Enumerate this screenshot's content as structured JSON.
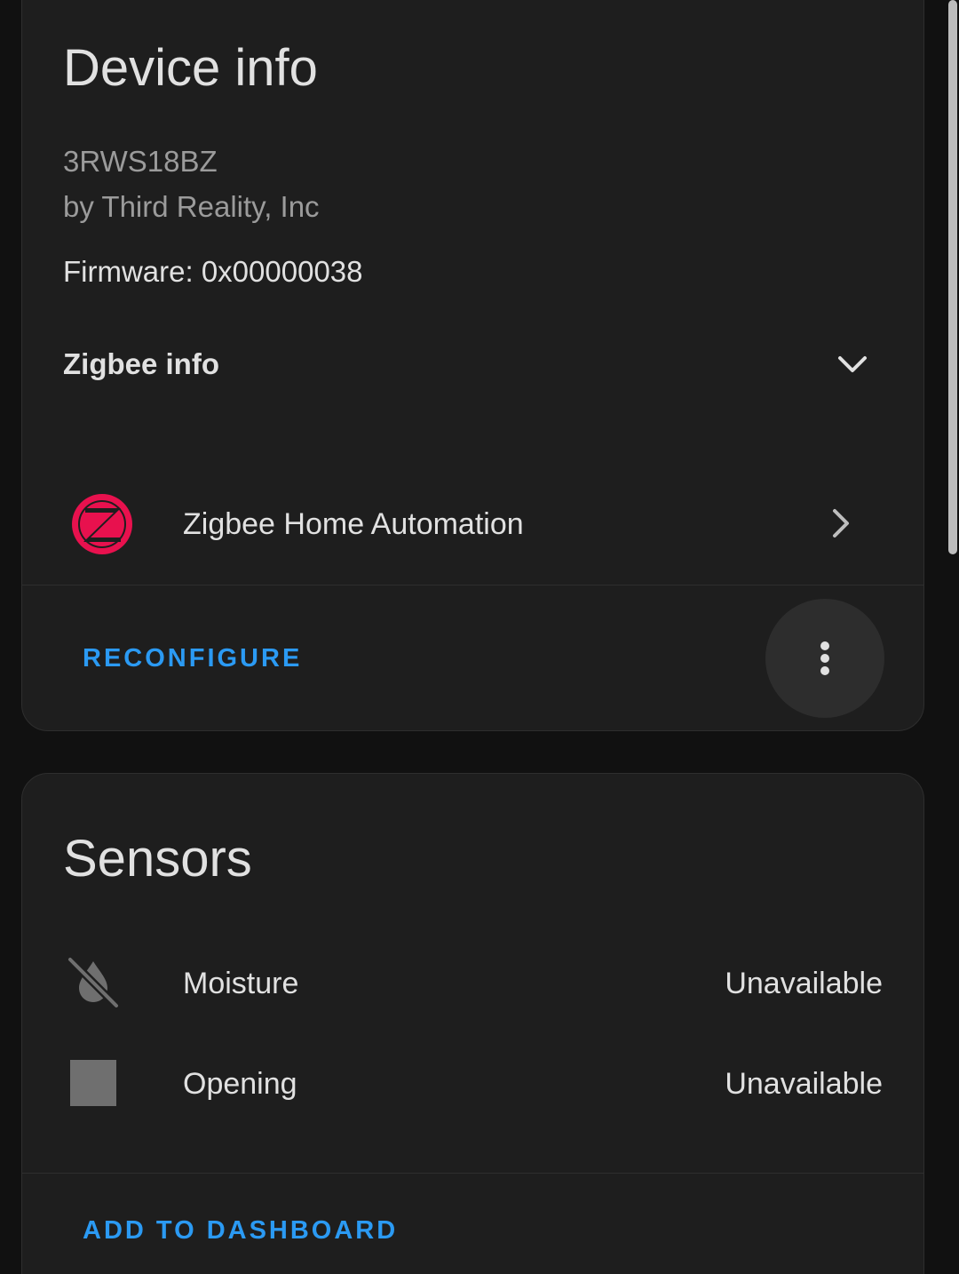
{
  "device_card": {
    "title": "Device info",
    "model": "3RWS18BZ",
    "manufacturer": "by Third Reality, Inc",
    "firmware": "Firmware: 0x00000038",
    "zigbee_info_label": "Zigbee info",
    "integration": {
      "label": "Zigbee Home Automation",
      "logo_icon": "zigbee-logo-icon",
      "logo_color": "#e8114e"
    },
    "reconfigure_label": "RECONFIGURE"
  },
  "sensors_card": {
    "title": "Sensors",
    "items": [
      {
        "name": "Moisture",
        "state": "Unavailable",
        "icon": "water-off-icon"
      },
      {
        "name": "Opening",
        "state": "Unavailable",
        "icon": "square-icon"
      }
    ],
    "add_to_dashboard_label": "ADD TO DASHBOARD"
  },
  "colors": {
    "background": "#111111",
    "card": "#1e1e1e",
    "accent": "#2b9af3",
    "primary_text": "#e1e1e1",
    "secondary_text": "#9b9b9b"
  }
}
